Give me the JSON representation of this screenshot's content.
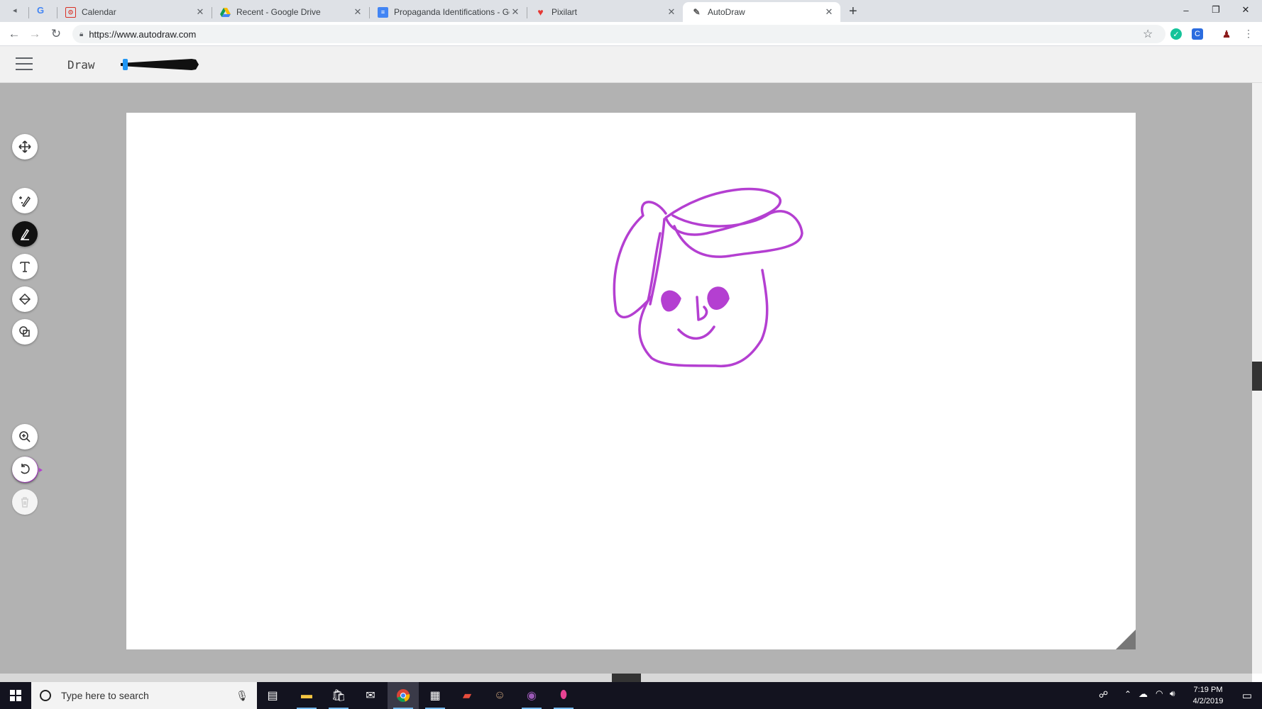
{
  "browser": {
    "tabs": [
      {
        "title": "Calendar",
        "favicon": "calendar-icon",
        "active": false
      },
      {
        "title": "Recent - Google Drive",
        "favicon": "google-drive-icon",
        "active": false
      },
      {
        "title": "Propaganda Identifications - Goo",
        "favicon": "google-docs-icon",
        "active": false
      },
      {
        "title": "Pixilart",
        "favicon": "pixilart-icon",
        "active": false
      },
      {
        "title": "AutoDraw",
        "favicon": "autodraw-icon",
        "active": true
      }
    ],
    "new_tab": "+",
    "url": "https://www.autodraw.com",
    "window_controls": {
      "minimize": "–",
      "restore": "❐",
      "close": "✕"
    }
  },
  "app": {
    "mode_label": "Draw",
    "stroke_width": 0.05,
    "tools": [
      {
        "name": "move-tool",
        "icon": "move-arrows-icon",
        "active": false
      },
      {
        "name": "autodraw-tool",
        "icon": "autodraw-pen-sparkle-icon",
        "active": false
      },
      {
        "name": "draw-tool",
        "icon": "pencil-icon",
        "active": true
      },
      {
        "name": "type-tool",
        "icon": "text-t-icon",
        "active": false
      },
      {
        "name": "fill-tool",
        "icon": "paint-bucket-icon",
        "active": false
      },
      {
        "name": "shape-tool",
        "icon": "shapes-icon",
        "active": false
      },
      {
        "name": "zoom-tool",
        "icon": "zoom-in-icon",
        "active": false
      },
      {
        "name": "undo-button",
        "icon": "undo-icon",
        "active": false
      },
      {
        "name": "delete-button",
        "icon": "trash-icon",
        "active": false,
        "disabled": true
      }
    ],
    "stroke_color": "#b43fd1"
  },
  "taskbar": {
    "search_placeholder": "Type here to search",
    "apps": [
      "task-view-icon",
      "file-explorer-icon",
      "store-icon",
      "mail-icon",
      "chrome-icon",
      "calculator-icon",
      "game-app-icon",
      "avatar-app-icon",
      "photo-app-icon",
      "maps-pin-icon"
    ],
    "time": "7:19 PM",
    "date": "4/2/2019"
  }
}
